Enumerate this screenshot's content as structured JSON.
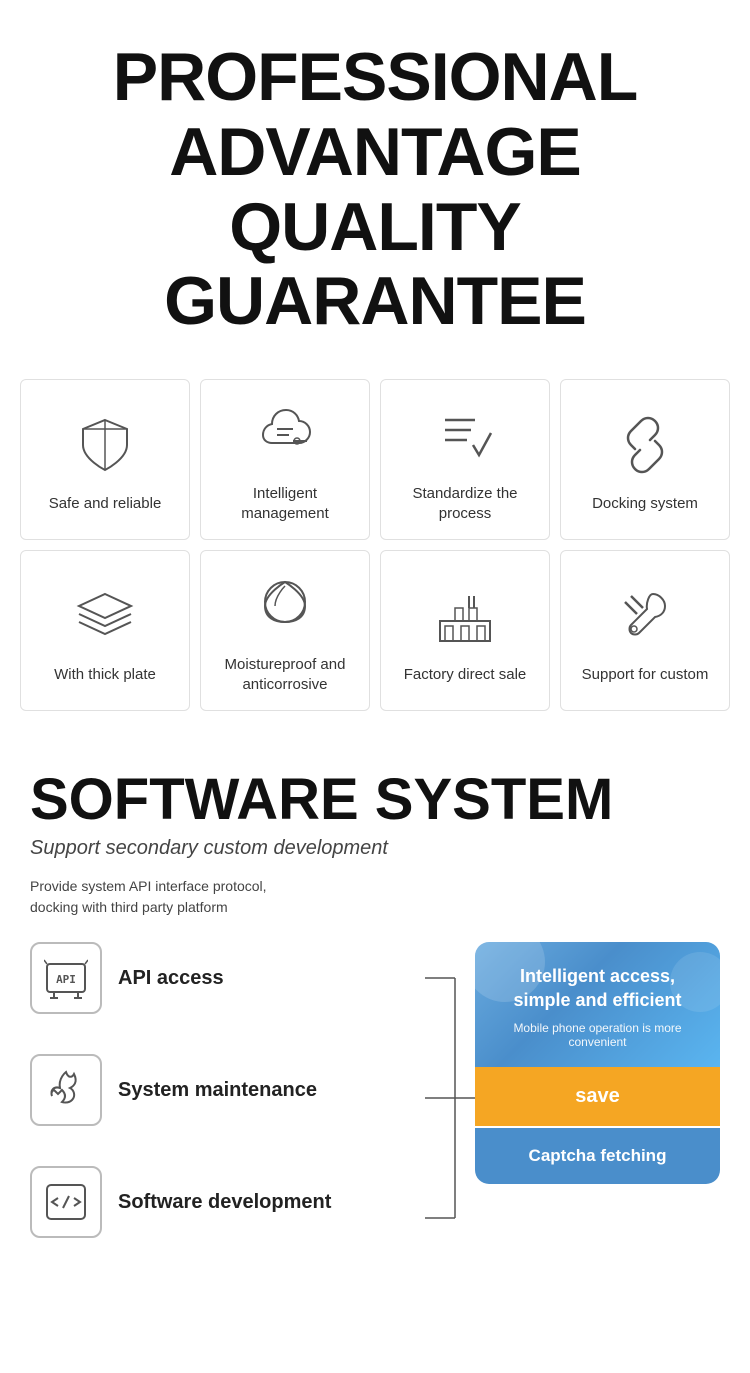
{
  "header": {
    "line1": "PROFESSIONAL",
    "line2": "ADVANTAGE",
    "line3": "QUALITY GUARANTEE"
  },
  "features": {
    "row1": [
      {
        "label": "Safe and reliable",
        "icon": "shield"
      },
      {
        "label": "Intelligent management",
        "icon": "cloud-settings"
      },
      {
        "label": "Standardize the process",
        "icon": "checklist"
      },
      {
        "label": "Docking system",
        "icon": "link"
      }
    ],
    "row2": [
      {
        "label": "With thick plate",
        "icon": "layers"
      },
      {
        "label": "Moistureproof and anticorrosive",
        "icon": "leaf"
      },
      {
        "label": "Factory direct sale",
        "icon": "factory"
      },
      {
        "label": "Support for custom",
        "icon": "tools"
      }
    ]
  },
  "software": {
    "title": "SOFTWARE SYSTEM",
    "subtitle": "Support secondary custom development",
    "description": "Provide system API interface protocol,\ndocking with third party platform",
    "items": [
      {
        "label": "API access",
        "icon": "api"
      },
      {
        "label": "System maintenance",
        "icon": "wrench"
      },
      {
        "label": "Software development",
        "icon": "code"
      }
    ],
    "panel": {
      "main_text": "Intelligent access, simple and efficient",
      "sub_text": "Mobile phone operation is more convenient",
      "save_label": "save",
      "captcha_label": "Captcha fetching"
    }
  }
}
